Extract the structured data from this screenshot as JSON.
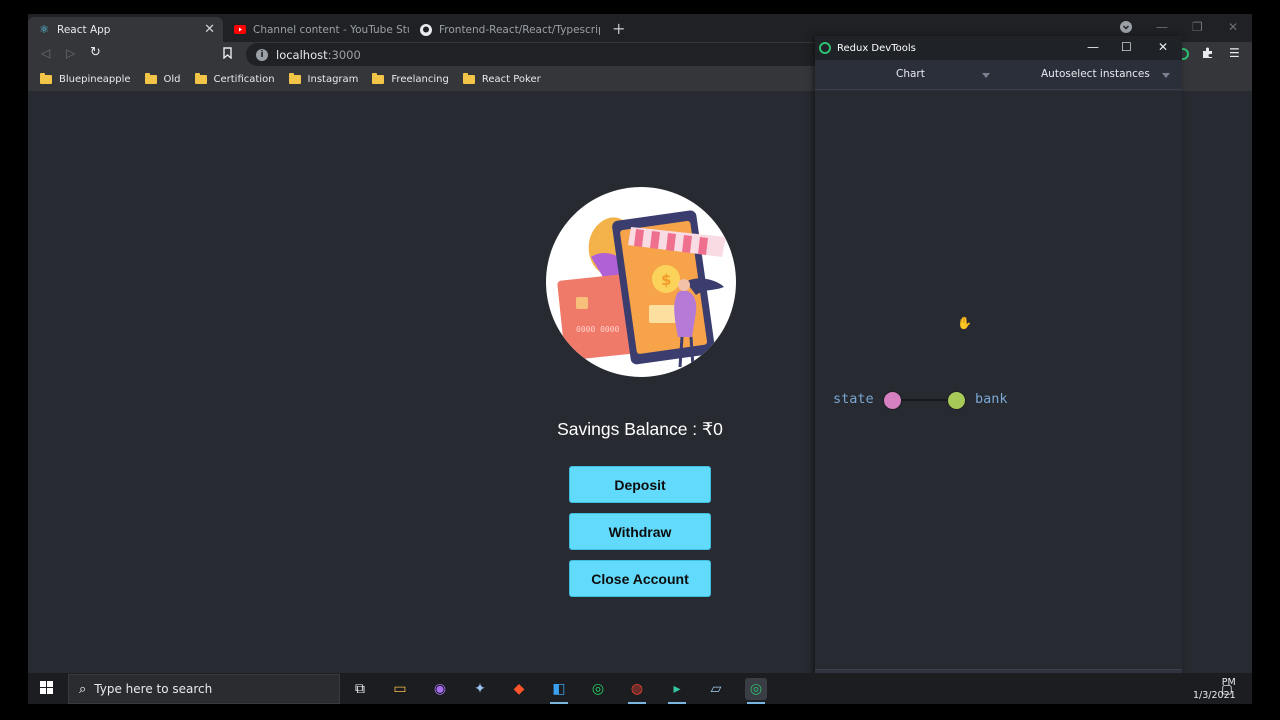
{
  "browser": {
    "tabs": [
      {
        "label": "React App",
        "icon": "react-icon",
        "active": true
      },
      {
        "label": "Channel content - YouTube Studio",
        "icon": "youtube-icon",
        "active": false
      },
      {
        "label": "Frontend-React/React/Typescript/bank",
        "icon": "github-icon",
        "active": false
      }
    ],
    "new_tab": "+",
    "url_host": "localhost",
    "url_port": ":3000",
    "bookmarks": [
      "Bluepineapple",
      "Old",
      "Certification",
      "Instagram",
      "Freelancing",
      "React Poker"
    ]
  },
  "app": {
    "balance_text": "Savings Balance : ₹0",
    "buttons": {
      "deposit": "Deposit",
      "withdraw": "Withdraw",
      "close": "Close Account"
    },
    "hero_text": "0000 0000"
  },
  "devtools": {
    "title": "Redux DevTools",
    "monitor": "Chart",
    "instances": "Autoselect instances",
    "tree": {
      "root": "state",
      "child": "bank",
      "root_color": "#d67fc1",
      "child_color": "#a7c957"
    }
  },
  "taskbar": {
    "search_placeholder": "Type here to search",
    "time": "PM",
    "date": "1/3/2021"
  },
  "colors": {
    "accent_button": "#61dafb",
    "page_bg": "#272b31"
  }
}
